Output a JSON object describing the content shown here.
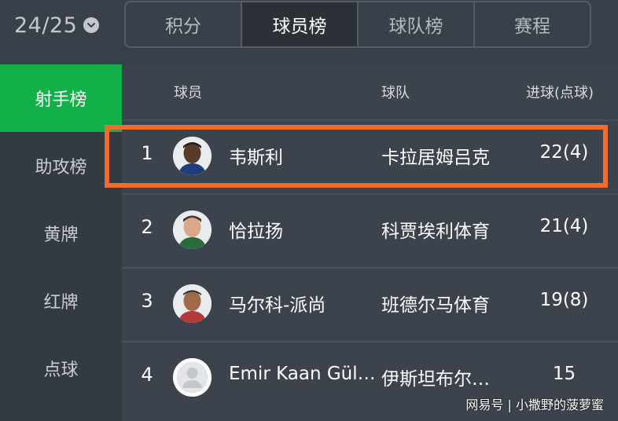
{
  "season": {
    "label": "24/25"
  },
  "tabs": [
    {
      "label": "积分",
      "active": false
    },
    {
      "label": "球员榜",
      "active": true
    },
    {
      "label": "球队榜",
      "active": false
    },
    {
      "label": "赛程",
      "active": false
    }
  ],
  "sidebar": {
    "items": [
      {
        "label": "射手榜",
        "active": true
      },
      {
        "label": "助攻榜",
        "active": false
      },
      {
        "label": "黄牌",
        "active": false
      },
      {
        "label": "红牌",
        "active": false
      },
      {
        "label": "点球",
        "active": false
      }
    ]
  },
  "table": {
    "headers": {
      "player": "球员",
      "team": "球队",
      "goals": "进球(点球)"
    },
    "rows": [
      {
        "rank": "1",
        "player": "韦斯利",
        "team": "卡拉居姆吕克",
        "goals": "22(4)",
        "avatar": "player-photo"
      },
      {
        "rank": "2",
        "player": "恰拉扬",
        "team": "科贾埃利体育",
        "goals": "21(4)",
        "avatar": "player-photo"
      },
      {
        "rank": "3",
        "player": "马尔科-派尚",
        "team": "班德尔马体育",
        "goals": "19(8)",
        "avatar": "player-photo"
      },
      {
        "rank": "4",
        "player": "Emir Kaan Gül…",
        "team": "伊斯坦布尔…",
        "goals": "15",
        "avatar": "placeholder-avatar"
      }
    ]
  },
  "credit": "网易号 | 小撒野的菠萝蜜",
  "colors": {
    "accent_green": "#13b04a",
    "highlight_orange": "#f26b2e",
    "background": "#3a4049"
  }
}
